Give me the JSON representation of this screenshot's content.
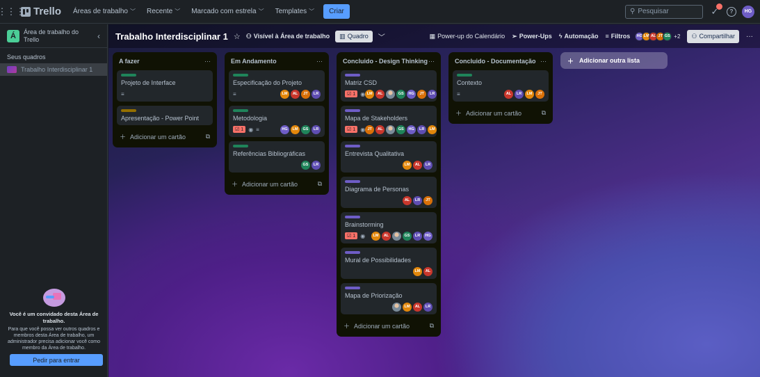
{
  "topbar": {
    "logo": "Trello",
    "nav": [
      "Áreas de trabalho",
      "Recente",
      "Marcado com estrela",
      "Templates"
    ],
    "create": "Criar",
    "search_placeholder": "Pesquisar",
    "user_initials": "HG"
  },
  "sidebar": {
    "workspace_initial": "Á",
    "workspace_name": "Área de trabalho do Trello",
    "boards_heading": "Seus quadros",
    "board_item": "Trabalho Interdisciplinar 1",
    "invite_title": "Você é um convidado desta Área de trabalho.",
    "invite_text": "Para que você possa ver outros quadros e membros desta Área de trabalho, um administrador precisa adicionar você como membro da Área de trabalho.",
    "request_button": "Pedir para entrar"
  },
  "board": {
    "title": "Trabalho Interdisciplinar 1",
    "visibility": "Visível à Área de trabalho",
    "view": "Quadro",
    "calendar": "Power-up do Calendário",
    "powerups": "Power-Ups",
    "automation": "Automação",
    "filters": "Filtros",
    "more_members": "+2",
    "share": "Compartilhar",
    "add_list": "Adicionar outra lista",
    "add_card": "Adicionar um cartão",
    "check_count": "1"
  },
  "colors": {
    "green": "#1f845a",
    "yellow": "#946f00",
    "purple": "#6e5dc6",
    "HG": "#6e5dc6",
    "LM": "#e2870b",
    "AL": "#c9372c",
    "JT": "#d97008",
    "GS": "#1f845a",
    "LR": "#5e4db2"
  },
  "members": [
    "HG",
    "LM",
    "AL",
    "JT",
    "GS"
  ],
  "lists": [
    {
      "title": "A fazer",
      "cards": [
        {
          "label": "green",
          "title": "Projeto de Interface",
          "desc": true,
          "check": false,
          "watch": false,
          "avatars": []
        },
        {
          "label": "yellow",
          "title": "Apresentação - Power Point",
          "desc": false,
          "check": false,
          "watch": false,
          "avatars": []
        }
      ]
    },
    {
      "title": "Em Andamento",
      "cards": [
        {
          "label": "green",
          "title": "Especificação do Projeto",
          "desc": true,
          "check": false,
          "watch": false,
          "avatars": [
            "LM",
            "AL",
            "JT",
            "LR"
          ]
        },
        {
          "label": "green",
          "title": "Metodologia",
          "desc": true,
          "check": true,
          "watch": true,
          "avatars": [
            "HG",
            "LM",
            "GS",
            "LR"
          ]
        },
        {
          "label": "green",
          "title": "Referências Bibliográficas",
          "desc": false,
          "check": false,
          "watch": false,
          "avatars": [
            "GS",
            "LR"
          ]
        }
      ]
    },
    {
      "title": "Concluido - Design Thinking",
      "cards": [
        {
          "label": "purple",
          "title": "Matriz CSD",
          "desc": false,
          "check": true,
          "watch": true,
          "avatars": [
            "LM",
            "AL",
            "PH",
            "GS",
            "HG",
            "JT",
            "LR"
          ]
        },
        {
          "label": "purple",
          "title": "Mapa de Stakeholders",
          "desc": false,
          "check": true,
          "watch": true,
          "avatars": [
            "JT",
            "AL",
            "PH",
            "GS",
            "HG",
            "LR",
            "LM"
          ]
        },
        {
          "label": "purple",
          "title": "Entrevista Qualitativa",
          "desc": false,
          "check": false,
          "watch": false,
          "avatars": [
            "LM",
            "AL",
            "LR"
          ]
        },
        {
          "label": "purple",
          "title": "Diagrama de Personas",
          "desc": false,
          "check": false,
          "watch": false,
          "avatars": [
            "AL",
            "LR",
            "JT"
          ]
        },
        {
          "label": "purple",
          "title": "Brainstorming",
          "desc": false,
          "check": true,
          "watch": true,
          "avatars": [
            "LM",
            "AL",
            "PH",
            "GS",
            "LR",
            "HG"
          ]
        },
        {
          "label": "purple",
          "title": "Mural de Possibilidades",
          "desc": false,
          "check": false,
          "watch": false,
          "avatars": [
            "LM",
            "AL"
          ]
        },
        {
          "label": "purple",
          "title": "Mapa de Priorização",
          "desc": false,
          "check": false,
          "watch": false,
          "avatars": [
            "PH",
            "LM",
            "AL",
            "LR"
          ]
        }
      ]
    },
    {
      "title": "Concluido - Documentação",
      "cards": [
        {
          "label": "green",
          "title": "Contexto",
          "desc": true,
          "check": false,
          "watch": false,
          "avatars": [
            "AL",
            "LR",
            "LM",
            "JT"
          ]
        }
      ]
    }
  ]
}
